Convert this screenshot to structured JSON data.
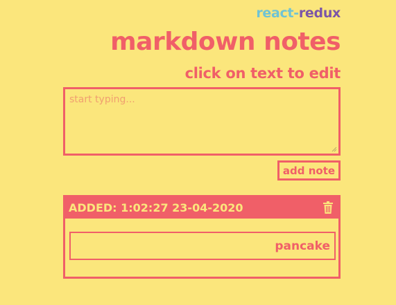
{
  "header": {
    "brand_react": "react",
    "brand_dash": "-",
    "brand_redux": "redux",
    "title": "markdown notes",
    "subtitle": "click on text to edit"
  },
  "editor": {
    "placeholder": "start typing...",
    "value": ""
  },
  "actions": {
    "add_note_label": "add note"
  },
  "notes": [
    {
      "added_label": "ADDED: 1:02:27 23-04-2020",
      "text": "pancake",
      "delete_icon": "trash-icon"
    }
  ],
  "colors": {
    "background": "#fbe67c",
    "accent": "#f05f68",
    "react": "#6fc3d4",
    "redux": "#7b55a8"
  }
}
